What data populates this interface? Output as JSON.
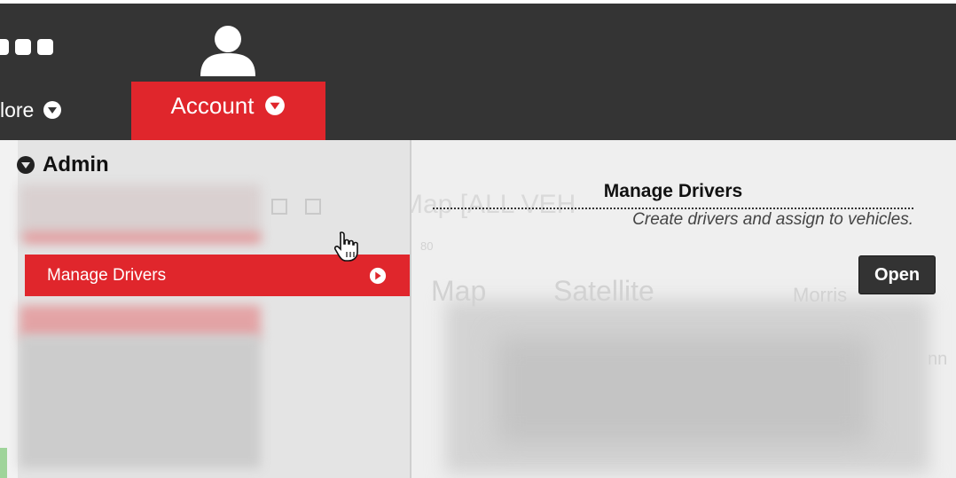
{
  "header": {
    "nav_more_label": "lore",
    "nav_account_label": "Account",
    "user_icon": "user-icon",
    "accent_color": "#e0262c",
    "bar_color": "#343434"
  },
  "menu": {
    "section_label": "Admin",
    "items": [
      {
        "label": "Manage Drivers",
        "selected": true
      }
    ]
  },
  "detail": {
    "title": "Manage Drivers",
    "description": "Create drivers and assign to vehicles.",
    "open_label": "Open"
  },
  "background": {
    "map_title": "Map  [ALL VEH",
    "tab_map": "Map",
    "tab_satellite": "Satellite",
    "place_label": "Morris",
    "route_badge_1": "80",
    "route_badge_2": "nn"
  }
}
